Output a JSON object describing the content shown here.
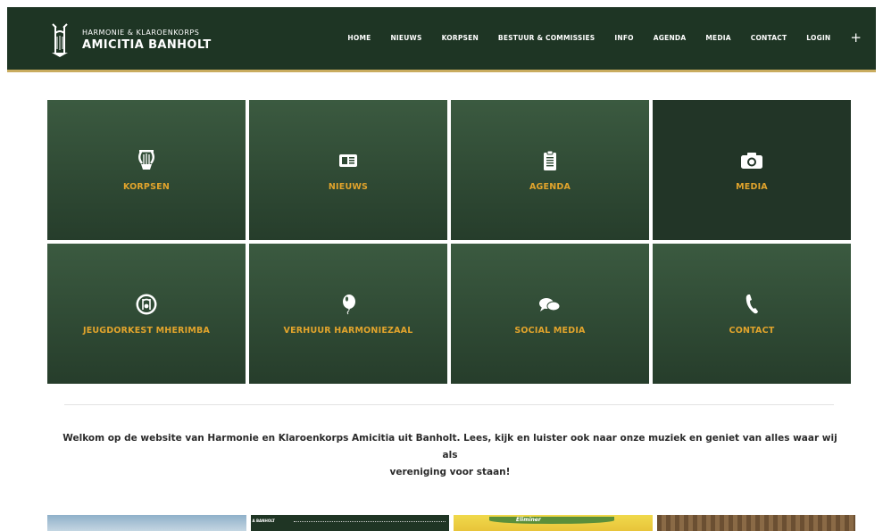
{
  "header": {
    "logo_top": "HARMONIE & KLAROENKORPS",
    "logo_main": "AMICITIA BANHOLT",
    "nav": [
      {
        "label": "HOME",
        "icon": ""
      },
      {
        "label": "NIEUWS"
      },
      {
        "label": "KORPSEN"
      },
      {
        "label": "BESTUUR & COMMISSIES"
      },
      {
        "label": "INFO"
      },
      {
        "label": "AGENDA"
      },
      {
        "label": "MEDIA"
      },
      {
        "label": "CONTACT"
      },
      {
        "label": "LOGIN"
      }
    ],
    "plus": "+"
  },
  "tiles": [
    {
      "label": "KORPSEN",
      "icon": "lyre-icon"
    },
    {
      "label": "NIEUWS",
      "icon": "newspaper-icon"
    },
    {
      "label": "AGENDA",
      "icon": "clipboard-icon"
    },
    {
      "label": "MEDIA",
      "icon": "camera-icon"
    },
    {
      "label": "JEUGDORKEST MHERIMBA",
      "icon": "mherimba-logo-icon"
    },
    {
      "label": "VERHUUR HARMONIEZAAL",
      "icon": "balloon-icon"
    },
    {
      "label": "SOCIAL MEDIA",
      "icon": "chat-bubbles-icon"
    },
    {
      "label": "CONTACT",
      "icon": "phone-icon"
    }
  ],
  "welcome": {
    "line1": "Welkom op de website van Harmonie en Klaroenkorps Amicitia uit Banholt. Lees, kijk en luister ook naar onze muziek en geniet van alles waar wij als",
    "line2": "vereniging voor staan!"
  },
  "thumbs": {
    "t2_text": "A BANHOLT",
    "t3_text": "Eliminer"
  },
  "colors": {
    "header_bg": "#1e3524",
    "accent_gold": "#c9ac5f",
    "tile_label": "#e2a42c",
    "tile_top": "#3b5a40",
    "tile_bottom": "#263d2b"
  }
}
